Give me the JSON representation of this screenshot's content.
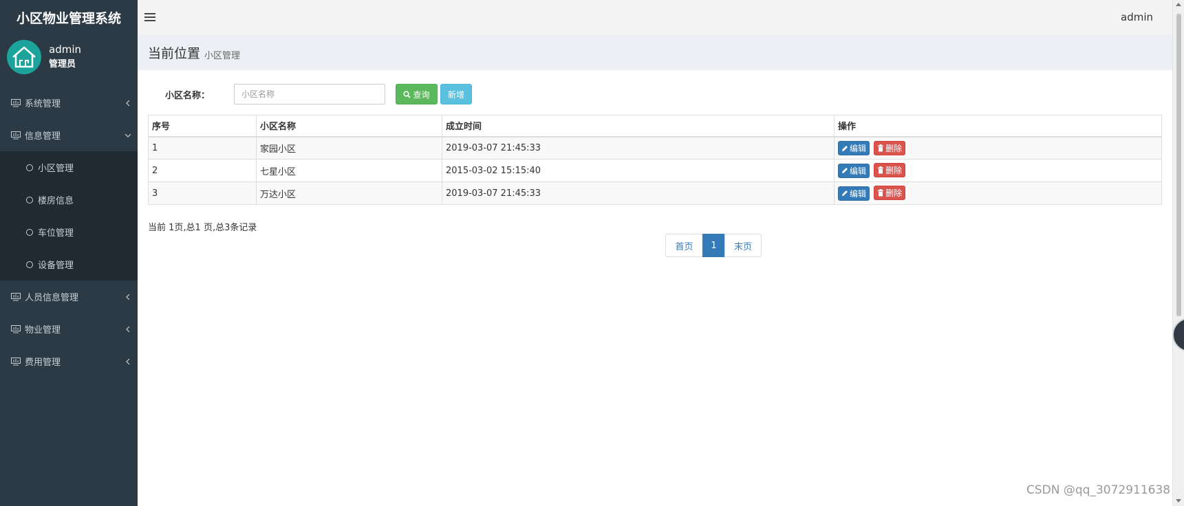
{
  "app": {
    "title": "小区物业管理系统"
  },
  "user": {
    "name": "admin",
    "role": "管理员"
  },
  "header": {
    "user_name": "admin"
  },
  "sidebar": {
    "items": [
      {
        "label": "系统管理"
      },
      {
        "label": "信息管理"
      },
      {
        "label": "人员信息管理"
      },
      {
        "label": "物业管理"
      },
      {
        "label": "费用管理"
      }
    ],
    "submenu": [
      {
        "label": "小区管理"
      },
      {
        "label": "楼房信息"
      },
      {
        "label": "车位管理"
      },
      {
        "label": "设备管理"
      }
    ]
  },
  "breadcrumb": {
    "title": "当前位置",
    "current": "小区管理"
  },
  "search": {
    "label": "小区名称：",
    "placeholder": "小区名称",
    "query_label": "查询",
    "add_label": "新增"
  },
  "table": {
    "columns": [
      "序号",
      "小区名称",
      "成立时间",
      "操作"
    ],
    "rows": [
      {
        "id": "1",
        "name": "家园小区",
        "time": "2019-03-07 21:45:33"
      },
      {
        "id": "2",
        "name": "七星小区",
        "time": "2015-03-02 15:15:40"
      },
      {
        "id": "3",
        "name": "万达小区",
        "time": "2019-03-07 21:45:33"
      }
    ],
    "edit_label": "编辑",
    "delete_label": "删除"
  },
  "pagination": {
    "info": "当前 1页,总1 页,总3条记录",
    "first": "首页",
    "current": "1",
    "last": "末页"
  },
  "watermark": "CSDN @qq_3072911638",
  "colors": {
    "sidebar": "#2b3a45",
    "accent": "#337ab7",
    "success": "#5cb85c",
    "info": "#5bc0de",
    "danger": "#d9534f"
  }
}
